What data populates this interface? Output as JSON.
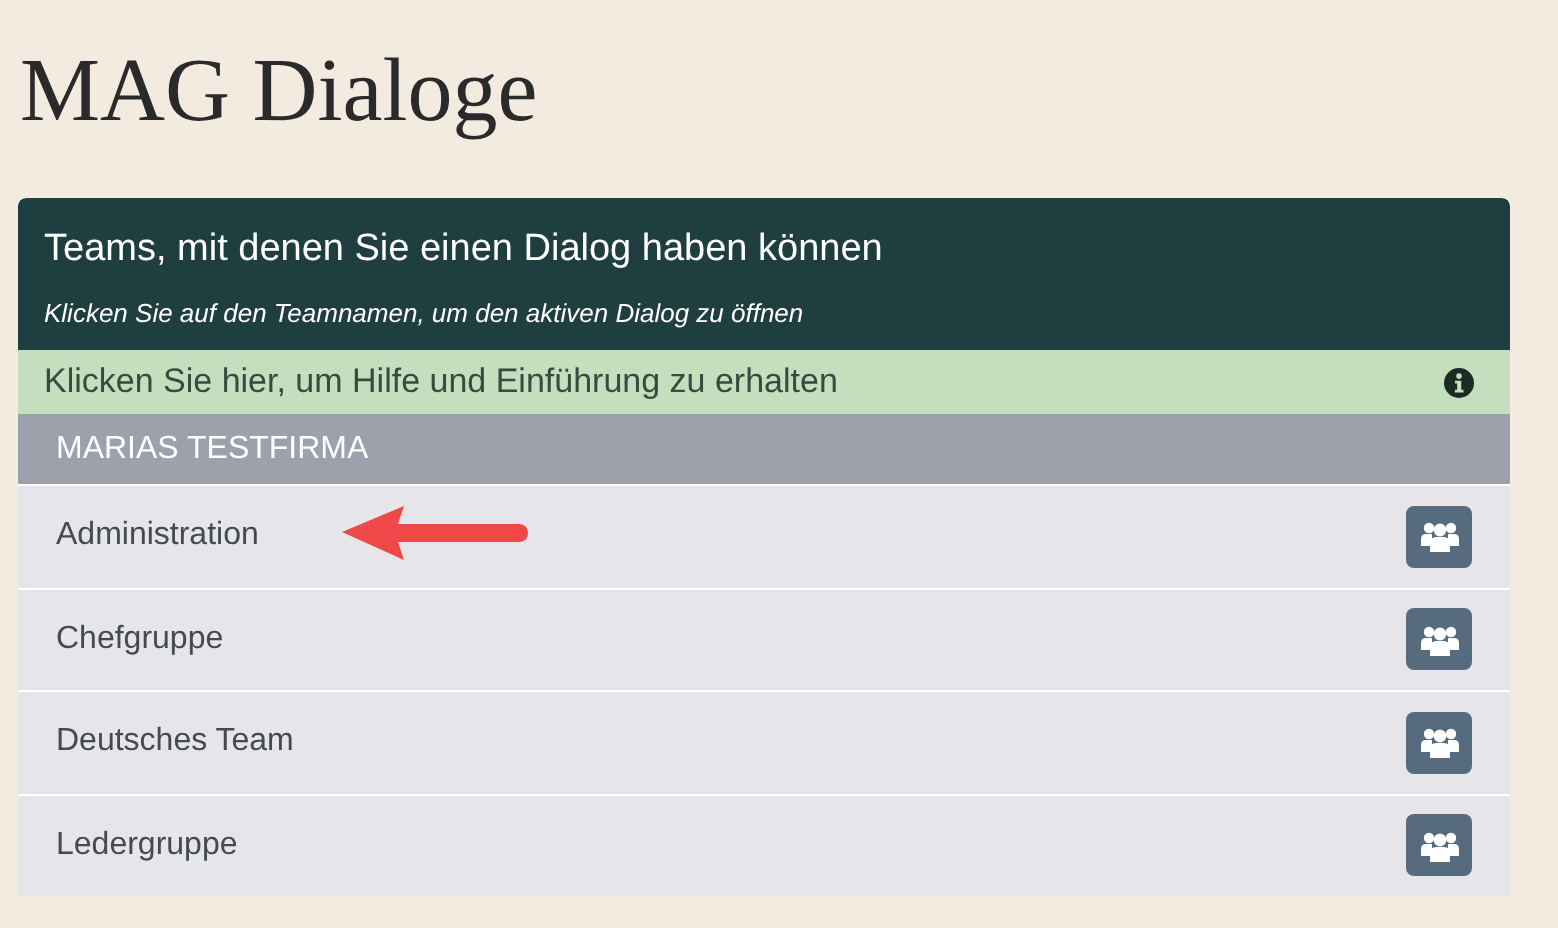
{
  "page_title": "MAG Dialoge",
  "panel": {
    "title": "Teams, mit denen Sie einen Dialog haben können",
    "subtitle": "Klicken Sie auf den Teamnamen, um den aktiven Dialog zu öffnen"
  },
  "help_bar": {
    "label": "Klicken Sie hier, um Hilfe und Einführung zu erhalten"
  },
  "company": {
    "name": "MARIAS TESTFIRMA"
  },
  "teams": [
    {
      "name": "Administration",
      "annotation": {
        "kind": "arrow"
      }
    },
    {
      "name": "Chefgruppe"
    },
    {
      "name": "Deutsches Team"
    },
    {
      "name": "Ledergruppe"
    }
  ]
}
